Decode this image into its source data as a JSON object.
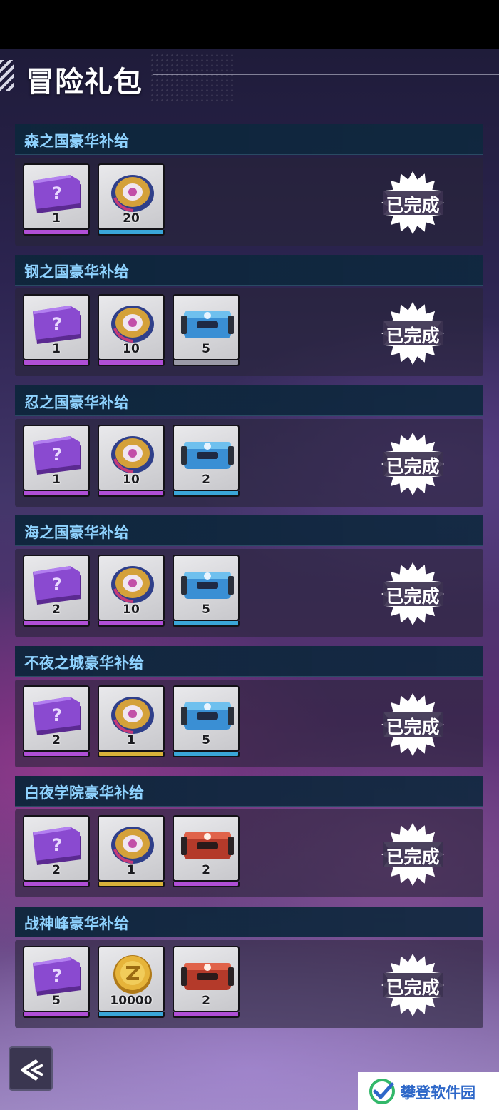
{
  "header": {
    "title": "冒险礼包"
  },
  "completed_label": "已完成",
  "colors": {
    "purple_bar": "#b04fd6",
    "blue_bar": "#3aa6d8",
    "gold_bar": "#d8b23a",
    "title_blue": "#8fd3ff"
  },
  "packs": [
    {
      "title": "森之国豪华补给",
      "items": [
        {
          "icon": "mystery-ticket-icon",
          "qty": "1",
          "rarity": "purple"
        },
        {
          "icon": "spinning-top-icon",
          "qty": "20",
          "rarity": "blue"
        }
      ]
    },
    {
      "title": "钢之国豪华补给",
      "items": [
        {
          "icon": "mystery-ticket-icon",
          "qty": "1",
          "rarity": "purple"
        },
        {
          "icon": "spinning-top-icon",
          "qty": "10",
          "rarity": "purple"
        },
        {
          "icon": "supply-chest-icon",
          "qty": "5",
          "rarity": "gray"
        }
      ]
    },
    {
      "title": "忍之国豪华补给",
      "items": [
        {
          "icon": "mystery-ticket-icon",
          "qty": "1",
          "rarity": "purple"
        },
        {
          "icon": "spinning-top-icon",
          "qty": "10",
          "rarity": "purple"
        },
        {
          "icon": "supply-chest-icon",
          "qty": "2",
          "rarity": "blue"
        }
      ]
    },
    {
      "title": "海之国豪华补给",
      "items": [
        {
          "icon": "mystery-ticket-icon",
          "qty": "2",
          "rarity": "purple"
        },
        {
          "icon": "spinning-top-icon",
          "qty": "10",
          "rarity": "purple"
        },
        {
          "icon": "supply-chest-icon",
          "qty": "5",
          "rarity": "blue"
        }
      ]
    },
    {
      "title": "不夜之城豪华补给",
      "items": [
        {
          "icon": "mystery-ticket-icon",
          "qty": "2",
          "rarity": "purple"
        },
        {
          "icon": "spinning-top-icon",
          "qty": "1",
          "rarity": "gold"
        },
        {
          "icon": "supply-chest-icon",
          "qty": "5",
          "rarity": "blue"
        }
      ]
    },
    {
      "title": "白夜学院豪华补给",
      "items": [
        {
          "icon": "mystery-ticket-icon",
          "qty": "2",
          "rarity": "purple"
        },
        {
          "icon": "spinning-top-icon",
          "qty": "1",
          "rarity": "gold"
        },
        {
          "icon": "red-chest-icon",
          "qty": "2",
          "rarity": "purple"
        }
      ]
    },
    {
      "title": "战神峰豪华补给",
      "items": [
        {
          "icon": "mystery-ticket-icon",
          "qty": "5",
          "rarity": "purple"
        },
        {
          "icon": "gold-coin-icon",
          "qty": "10000",
          "rarity": "blue"
        },
        {
          "icon": "red-chest-icon",
          "qty": "2",
          "rarity": "purple"
        }
      ]
    }
  ],
  "watermark": {
    "text": "攀登软件园"
  },
  "back_button": {
    "icon": "back-arrow-icon"
  }
}
